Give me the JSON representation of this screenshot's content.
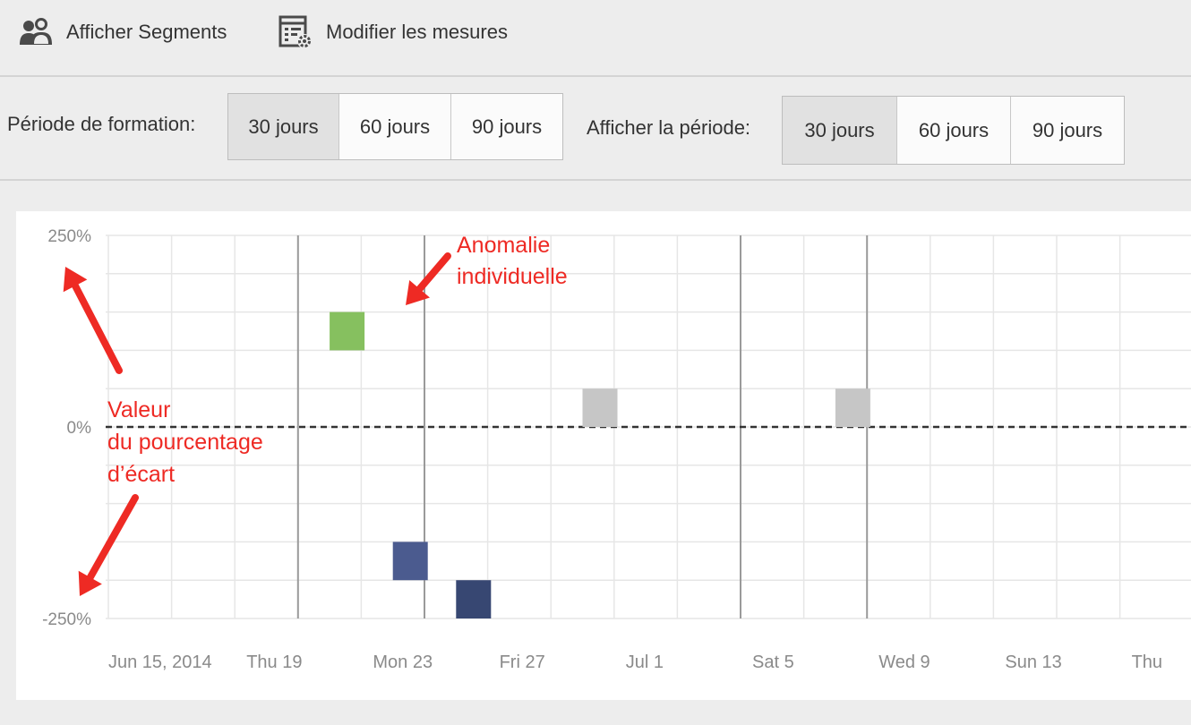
{
  "toolbar": {
    "show_segments": {
      "label": "Afficher Segments",
      "icon": "segments-people-icon"
    },
    "edit_metrics": {
      "label": "Modifier les mesures",
      "icon": "metrics-settings-icon"
    }
  },
  "training_period": {
    "label": "Période de formation:",
    "options": [
      "30 jours",
      "60 jours",
      "90 jours"
    ],
    "selected": "30 jours"
  },
  "display_period": {
    "label": "Afficher la période:",
    "options": [
      "30 jours",
      "60 jours",
      "90 jours"
    ],
    "selected": "30 jours"
  },
  "chart_data": {
    "type": "heatmap",
    "y_tick_labels": [
      "250%",
      "0%",
      "-250%"
    ],
    "ylim": [
      -250,
      250
    ],
    "x_tick_labels": [
      "Jun 15, 2014",
      "Thu 19",
      "Mon 23",
      "Fri 27",
      "Jul 1",
      "Sat 5",
      "Wed 9",
      "Sun 13",
      "Thu"
    ],
    "grid": true,
    "zero_line": "dashed",
    "cells": [
      {
        "date": "2014-06-22",
        "y": 125,
        "color": "#86c05f"
      },
      {
        "date": "2014-06-24",
        "y": -175,
        "color": "#4b5b8f"
      },
      {
        "date": "2014-06-26",
        "y": -225,
        "color": "#374772"
      },
      {
        "date": "2014-06-30",
        "y": 25,
        "color": "#c6c6c6"
      },
      {
        "date": "2014-07-08",
        "y": 25,
        "color": "#c6c6c6"
      }
    ],
    "annotations": {
      "anomaly": [
        "Anomalie",
        "individuelle"
      ],
      "deviation": [
        "Valeur",
        "du pourcentage",
        "d’écart"
      ],
      "color": "#ee2a24"
    }
  }
}
